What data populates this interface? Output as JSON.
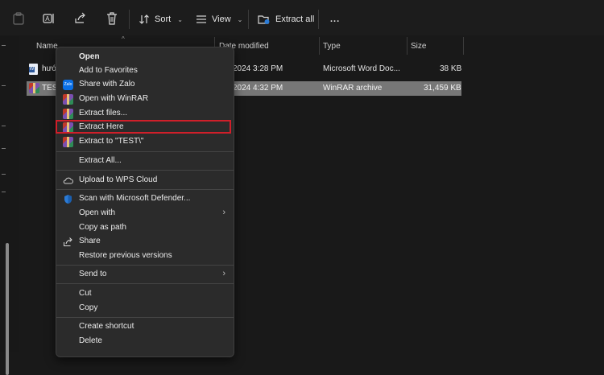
{
  "toolbar": {
    "sort_label": "Sort",
    "view_label": "View",
    "extract_all_label": "Extract all",
    "more_label": "..."
  },
  "columns": {
    "name": "Name",
    "date_modified": "Date modified",
    "type": "Type",
    "size": "Size"
  },
  "files": [
    {
      "name": "hướ",
      "date": "2024 3:28 PM",
      "type": "Microsoft Word Doc...",
      "size": "38 KB",
      "icon": "word-document-icon"
    },
    {
      "name": "TEST",
      "date": "2024 4:32 PM",
      "type": "WinRAR archive",
      "size": "31,459 KB",
      "icon": "winrar-icon",
      "selected": true
    }
  ],
  "context_menu": {
    "items": [
      {
        "label": "Open",
        "icon": null
      },
      {
        "label": "Add to Favorites",
        "icon": null
      },
      {
        "label": "Share with Zalo",
        "icon": "zalo-icon"
      },
      {
        "label": "Open with WinRAR",
        "icon": "winrar-icon"
      },
      {
        "label": "Extract files...",
        "icon": "winrar-icon"
      },
      {
        "label": "Extract Here",
        "icon": "winrar-icon",
        "highlighted": true
      },
      {
        "label": "Extract to \"TEST\\\"",
        "icon": "winrar-icon"
      },
      {
        "label": "Extract All...",
        "icon": null
      },
      {
        "label": "Upload to WPS Cloud",
        "icon": "cloud-icon"
      },
      {
        "label": "Scan with Microsoft Defender...",
        "icon": "shield-icon"
      },
      {
        "label": "Open with",
        "icon": null,
        "submenu": true
      },
      {
        "label": "Copy as path",
        "icon": null
      },
      {
        "label": "Share",
        "icon": "share-icon"
      },
      {
        "label": "Restore previous versions",
        "icon": null
      },
      {
        "label": "Send to",
        "icon": null,
        "submenu": true
      },
      {
        "label": "Cut",
        "icon": null
      },
      {
        "label": "Copy",
        "icon": null
      },
      {
        "label": "Create shortcut",
        "icon": null
      },
      {
        "label": "Delete",
        "icon": null
      }
    ]
  },
  "colors": {
    "highlight_border": "#d01f2a",
    "selected_row": "#777777",
    "menu_bg": "#2b2b2b"
  }
}
